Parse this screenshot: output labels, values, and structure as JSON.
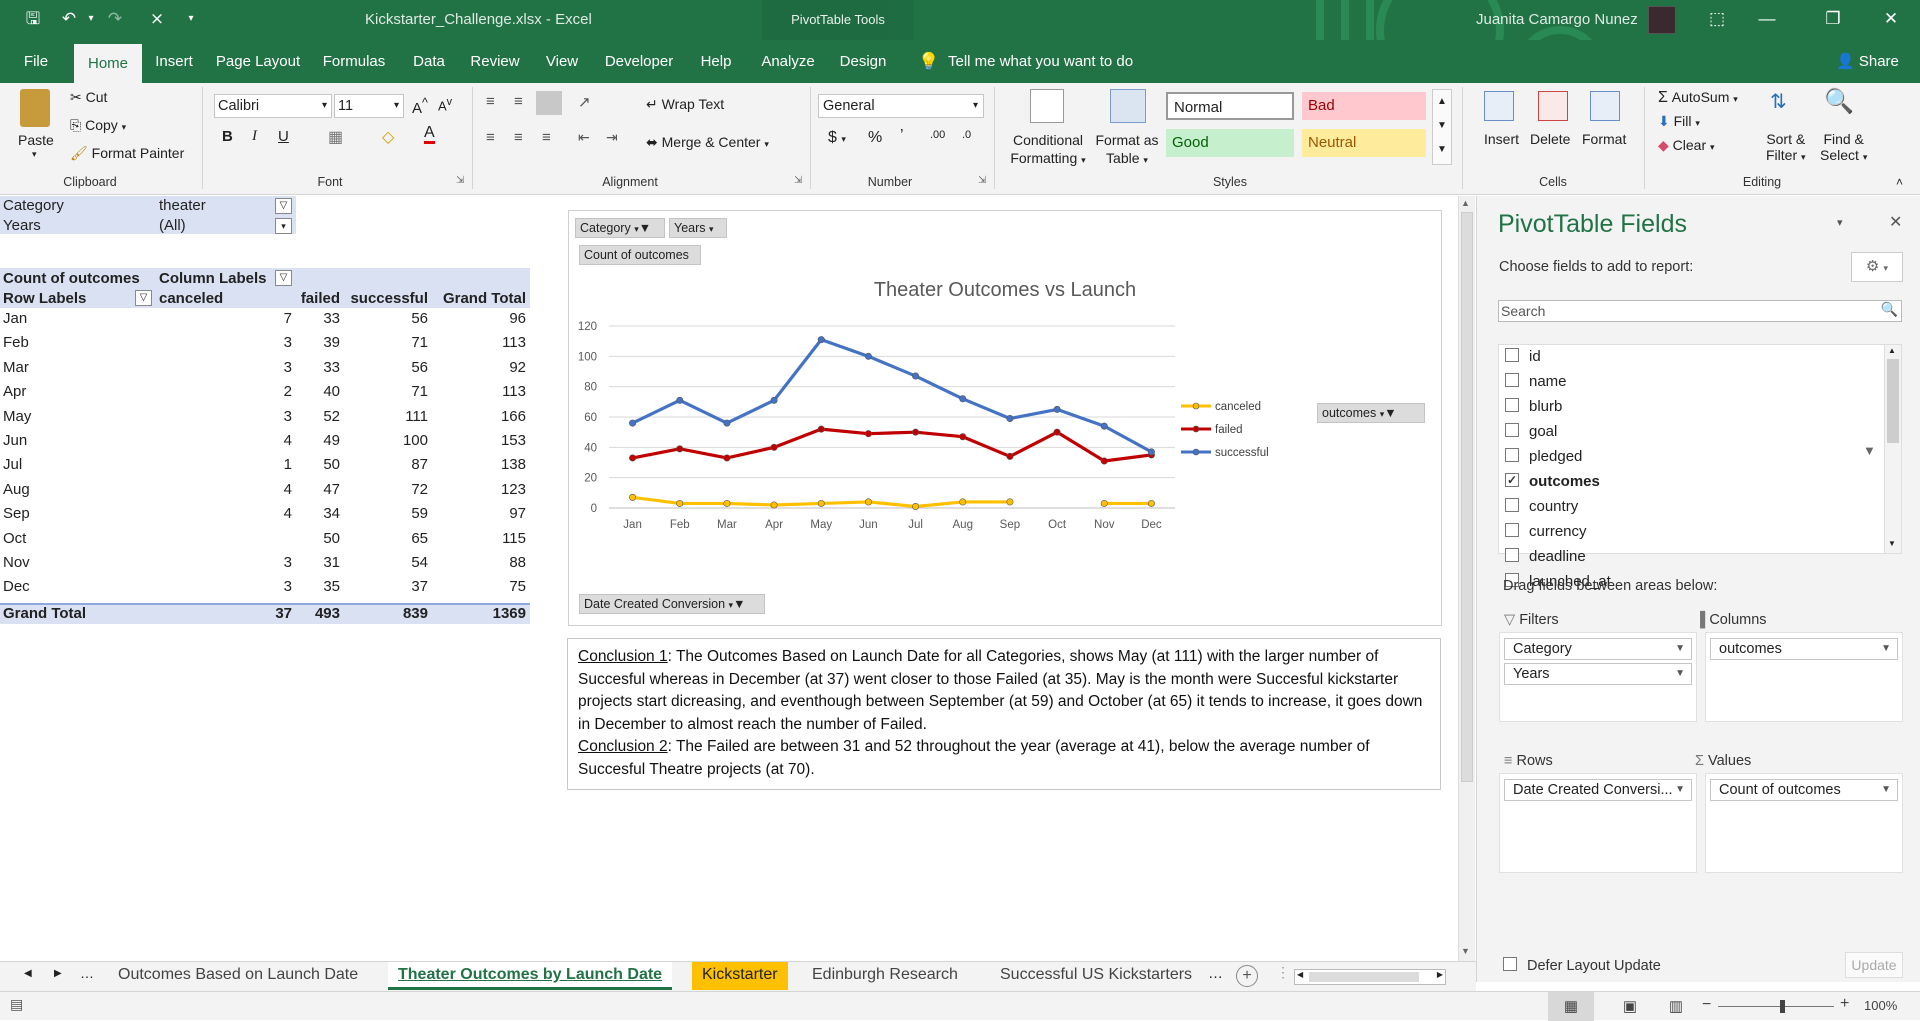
{
  "window": {
    "file_title": "Kickstarter_Challenge.xlsx",
    "app_name": "Excel",
    "context_tools": "PivotTable Tools",
    "user_name": "Juanita Camargo Nunez"
  },
  "tabs": [
    "File",
    "Home",
    "Insert",
    "Page Layout",
    "Formulas",
    "Data",
    "Review",
    "View",
    "Developer",
    "Help",
    "Analyze",
    "Design"
  ],
  "tell_me": "Tell me what you want to do",
  "share": "Share",
  "ribbon": {
    "clipboard": {
      "paste": "Paste",
      "cut": "Cut",
      "copy": "Copy",
      "format_painter": "Format Painter",
      "label": "Clipboard"
    },
    "font": {
      "name": "Calibri",
      "size": "11",
      "label": "Font"
    },
    "alignment": {
      "wrap_text": "Wrap Text",
      "merge_center": "Merge & Center",
      "label": "Alignment"
    },
    "number": {
      "format": "General",
      "label": "Number"
    },
    "styles": {
      "conditional_1": "Conditional",
      "conditional_2": "Formatting",
      "format_table_1": "Format as",
      "format_table_2": "Table",
      "normal": "Normal",
      "bad": "Bad",
      "good": "Good",
      "neutral": "Neutral",
      "label": "Styles"
    },
    "cells": {
      "insert": "Insert",
      "delete": "Delete",
      "format": "Format",
      "label": "Cells"
    },
    "editing": {
      "autosum": "AutoSum",
      "fill": "Fill",
      "clear": "Clear",
      "sort_1": "Sort &",
      "sort_2": "Filter",
      "find_1": "Find &",
      "find_2": "Select",
      "label": "Editing"
    }
  },
  "pivot": {
    "filter_category_label": "Category",
    "filter_category_value": "theater",
    "filter_years_label": "Years",
    "filter_years_value": "(All)",
    "count_label": "Count of outcomes",
    "column_labels": "Column Labels",
    "row_labels": "Row Labels",
    "headers": [
      "canceled",
      "failed",
      "successful",
      "Grand Total"
    ],
    "rows": [
      {
        "month": "Jan",
        "canceled": "7",
        "failed": "33",
        "successful": "56",
        "total": "96"
      },
      {
        "month": "Feb",
        "canceled": "3",
        "failed": "39",
        "successful": "71",
        "total": "113"
      },
      {
        "month": "Mar",
        "canceled": "3",
        "failed": "33",
        "successful": "56",
        "total": "92"
      },
      {
        "month": "Apr",
        "canceled": "2",
        "failed": "40",
        "successful": "71",
        "total": "113"
      },
      {
        "month": "May",
        "canceled": "3",
        "failed": "52",
        "successful": "111",
        "total": "166"
      },
      {
        "month": "Jun",
        "canceled": "4",
        "failed": "49",
        "successful": "100",
        "total": "153"
      },
      {
        "month": "Jul",
        "canceled": "1",
        "failed": "50",
        "successful": "87",
        "total": "138"
      },
      {
        "month": "Aug",
        "canceled": "4",
        "failed": "47",
        "successful": "72",
        "total": "123"
      },
      {
        "month": "Sep",
        "canceled": "4",
        "failed": "34",
        "successful": "59",
        "total": "97"
      },
      {
        "month": "Oct",
        "canceled": "",
        "failed": "50",
        "successful": "65",
        "total": "115"
      },
      {
        "month": "Nov",
        "canceled": "3",
        "failed": "31",
        "successful": "54",
        "total": "88"
      },
      {
        "month": "Dec",
        "canceled": "3",
        "failed": "35",
        "successful": "37",
        "total": "75"
      }
    ],
    "grand_total_label": "Grand Total",
    "grand_total": {
      "canceled": "37",
      "failed": "493",
      "successful": "839",
      "total": "1369"
    }
  },
  "chart_buttons": {
    "category": "Category",
    "years": "Years",
    "count": "Count of outcomes",
    "date": "Date Created Conversion",
    "legend_field": "outcomes"
  },
  "chart_data": {
    "type": "line",
    "title": "Theater Outcomes vs Launch",
    "categories": [
      "Jan",
      "Feb",
      "Mar",
      "Apr",
      "May",
      "Jun",
      "Jul",
      "Aug",
      "Sep",
      "Oct",
      "Nov",
      "Dec"
    ],
    "series": [
      {
        "name": "canceled",
        "color": "#ffc000",
        "values": [
          7,
          3,
          3,
          2,
          3,
          4,
          1,
          4,
          4,
          null,
          3,
          3
        ]
      },
      {
        "name": "failed",
        "color": "#c00000",
        "values": [
          33,
          39,
          33,
          40,
          52,
          49,
          50,
          47,
          34,
          50,
          31,
          35
        ]
      },
      {
        "name": "successful",
        "color": "#4472c4",
        "values": [
          56,
          71,
          56,
          71,
          111,
          100,
          87,
          72,
          59,
          65,
          54,
          37
        ]
      }
    ],
    "ylim": [
      0,
      120
    ],
    "yticks": [
      0,
      20,
      40,
      60,
      80,
      100,
      120
    ],
    "grid": true,
    "legend": "right"
  },
  "conclusion": {
    "c1_label": "Conclusion 1",
    "c1_text": ": The Outcomes Based on Launch Date for all Categories, shows May (at 111) with the larger number of Succesful whereas in December (at 37) went closer to those Failed (at 35). May is the month were Succesful kickstarter projects start dicreasing, and eventhough between September (at 59)  and October (at 65) it tends to increase, it goes down  in December to almost reach the number of Failed.",
    "c2_label": "Conclusion 2",
    "c2_text": ": The Failed are between 31 and 52 throughout the year (average at 41), below the average number of Succesful Theatre projects (at 70)."
  },
  "panel": {
    "title": "PivotTable Fields",
    "subtitle": "Choose fields to add to report:",
    "search_placeholder": "Search",
    "fields": [
      {
        "name": "id",
        "checked": false
      },
      {
        "name": "name",
        "checked": false
      },
      {
        "name": "blurb",
        "checked": false
      },
      {
        "name": "goal",
        "checked": false
      },
      {
        "name": "pledged",
        "checked": false
      },
      {
        "name": "outcomes",
        "checked": true
      },
      {
        "name": "country",
        "checked": false
      },
      {
        "name": "currency",
        "checked": false
      },
      {
        "name": "deadline",
        "checked": false
      },
      {
        "name": "launched_at",
        "checked": false
      }
    ],
    "drag_label": "Drag fields between areas below:",
    "filters_label": "Filters",
    "columns_label": "Columns",
    "rows_label": "Rows",
    "values_label": "Values",
    "filters": [
      "Category",
      "Years"
    ],
    "columns": [
      "outcomes"
    ],
    "rows": [
      "Date Created Conversi..."
    ],
    "values": [
      "Count of outcomes"
    ],
    "defer": "Defer Layout Update",
    "update": "Update"
  },
  "sheet_tabs": [
    {
      "name": "Outcomes Based on Launch Date",
      "state": "normal"
    },
    {
      "name": "Theater Outcomes by Launch Date",
      "state": "active"
    },
    {
      "name": "Kickstarter",
      "state": "highlight"
    },
    {
      "name": "Edinburgh Research",
      "state": "normal"
    },
    {
      "name": "Successful US Kickstarters",
      "state": "normal"
    }
  ],
  "status": {
    "zoom": "100%"
  }
}
